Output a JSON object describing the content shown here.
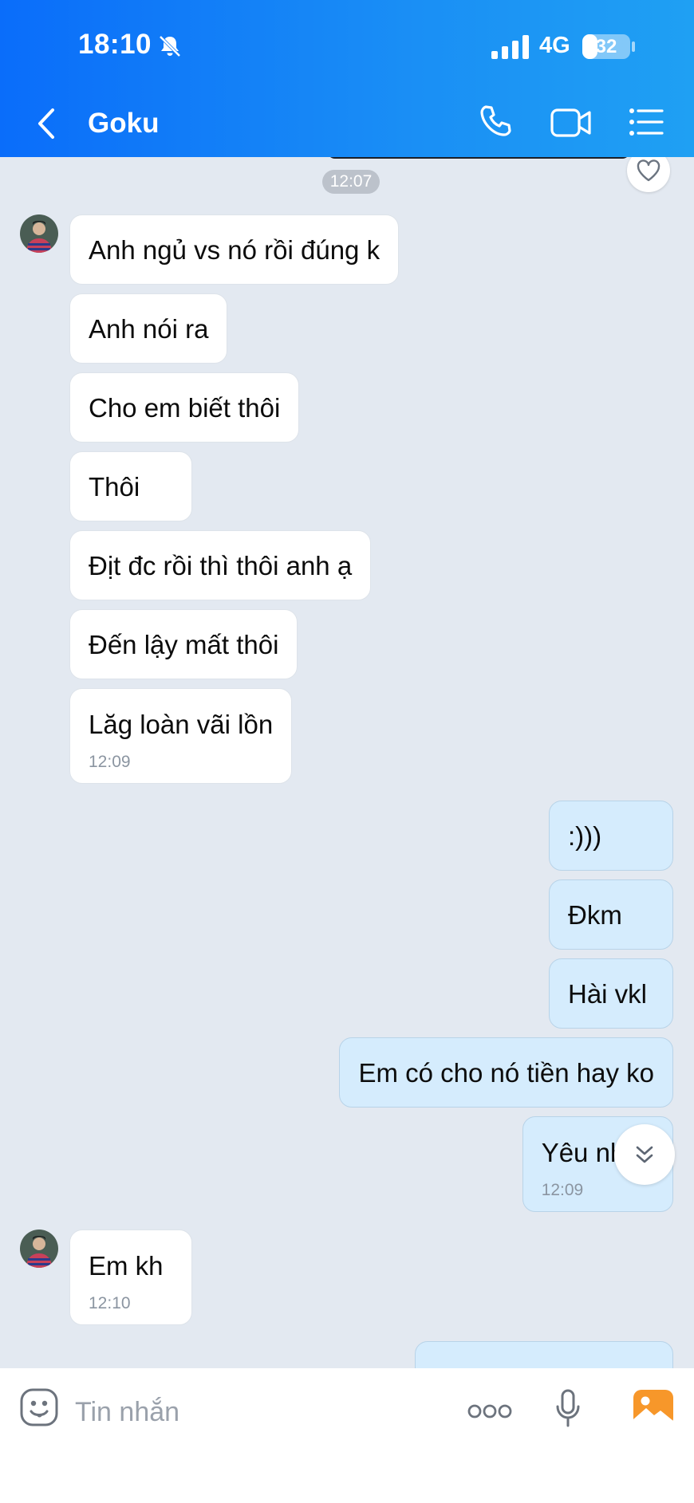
{
  "status_bar": {
    "time": "18:10",
    "network": "4G",
    "battery": "32",
    "battery_level_percent": 32
  },
  "header": {
    "contact_name": "Goku",
    "back_icon": "chevron-left-icon",
    "call_icon": "phone-icon",
    "video_icon": "video-camera-icon",
    "menu_icon": "list-menu-icon"
  },
  "chat": {
    "time_separator": "12:07",
    "messages": [
      {
        "dir": "in",
        "text": "Anh ngủ vs nó rồi đúng k"
      },
      {
        "dir": "in",
        "text": "Anh nói ra"
      },
      {
        "dir": "in",
        "text": "Cho em biết thôi"
      },
      {
        "dir": "in",
        "text": "Thôi"
      },
      {
        "dir": "in",
        "text": "Địt đc rồi thì thôi anh ạ"
      },
      {
        "dir": "in",
        "text": "Đến lậy mất thôi"
      },
      {
        "dir": "in",
        "text": "Lăg loàn vãi lồn",
        "time": "12:09"
      },
      {
        "dir": "out",
        "text": ":)))"
      },
      {
        "dir": "out",
        "text": "Đkm"
      },
      {
        "dir": "out",
        "text": "Hài vkl"
      },
      {
        "dir": "out",
        "text": "Em có cho nó tiền hay ko"
      },
      {
        "dir": "out",
        "text": "Yêu nhau",
        "time": "12:09"
      },
      {
        "dir": "in",
        "text": "Em kh",
        "time": "12:10"
      }
    ]
  },
  "composer": {
    "placeholder": "Tin nhắn",
    "emoji_icon": "sticker-smiley-icon",
    "more_icon": "more-dots-icon",
    "mic_icon": "microphone-icon",
    "gallery_icon": "image-gallery-icon"
  },
  "colors": {
    "header_start": "#0a6dfa",
    "header_end": "#1fa0f3",
    "chat_bg": "#e3e9f1",
    "incoming_bubble": "#ffffff",
    "outgoing_bubble": "#d5ecfd",
    "gallery_orange": "#f7972a"
  }
}
